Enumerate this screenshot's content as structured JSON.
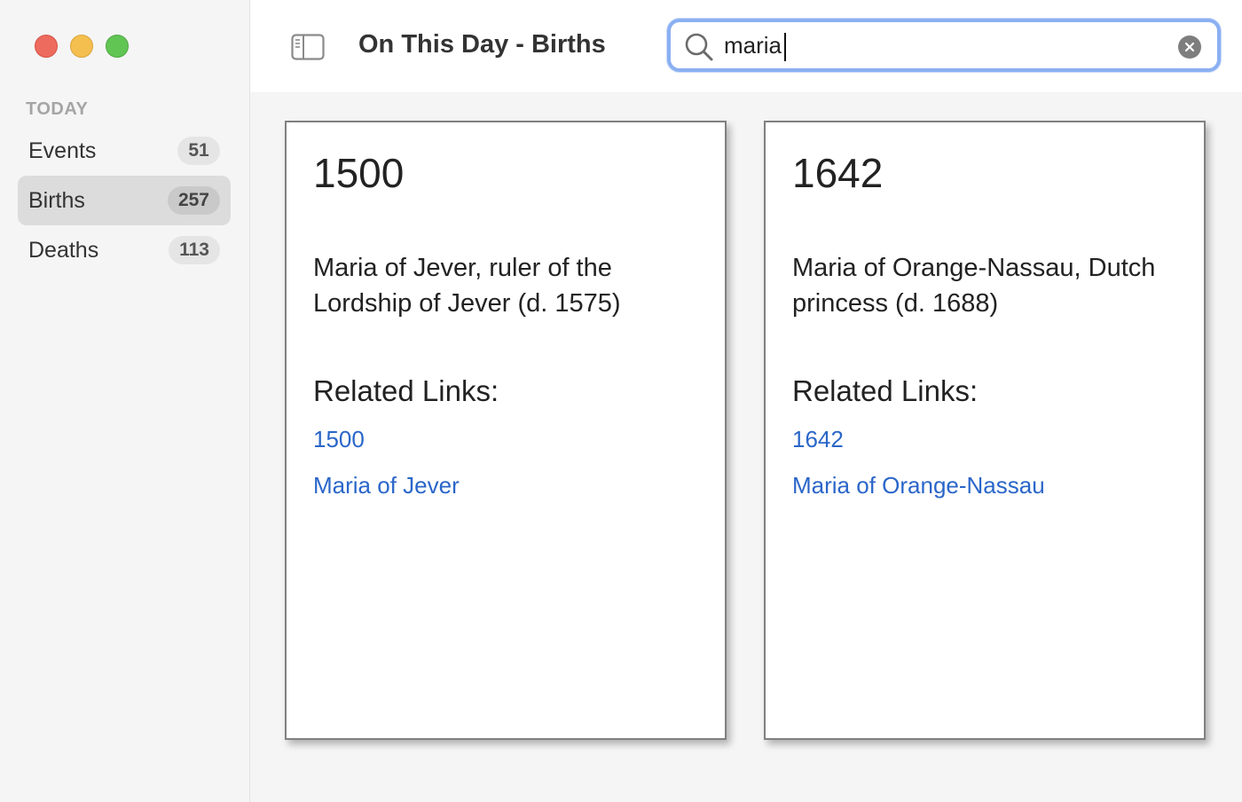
{
  "window": {
    "title": "On This Day - Births"
  },
  "sidebar": {
    "section_header": "TODAY",
    "items": [
      {
        "label": "Events",
        "count": "51",
        "selected": false
      },
      {
        "label": "Births",
        "count": "257",
        "selected": true
      },
      {
        "label": "Deaths",
        "count": "113",
        "selected": false
      }
    ]
  },
  "search": {
    "value": "maria",
    "placeholder": "Search"
  },
  "cards": [
    {
      "year": "1500",
      "description": "Maria of Jever, ruler of the Lordship of Jever (d. 1575)",
      "related_title": "Related Links:",
      "links": [
        "1500",
        "Maria of Jever"
      ]
    },
    {
      "year": "1642",
      "description": "Maria of Orange-Nassau, Dutch princess (d. 1688)",
      "related_title": "Related Links:",
      "links": [
        "1642",
        "Maria of Orange-Nassau"
      ]
    }
  ],
  "colors": {
    "accent": "#2a66c9",
    "focus_ring": "#8ab0f2",
    "close": "#ed6a5e",
    "minimize": "#f5bf4f",
    "zoom": "#61c554"
  },
  "icons": {
    "sidebar_toggle": "sidebar-toggle-icon",
    "search": "magnifier-icon",
    "clear": "clear-x-icon"
  }
}
